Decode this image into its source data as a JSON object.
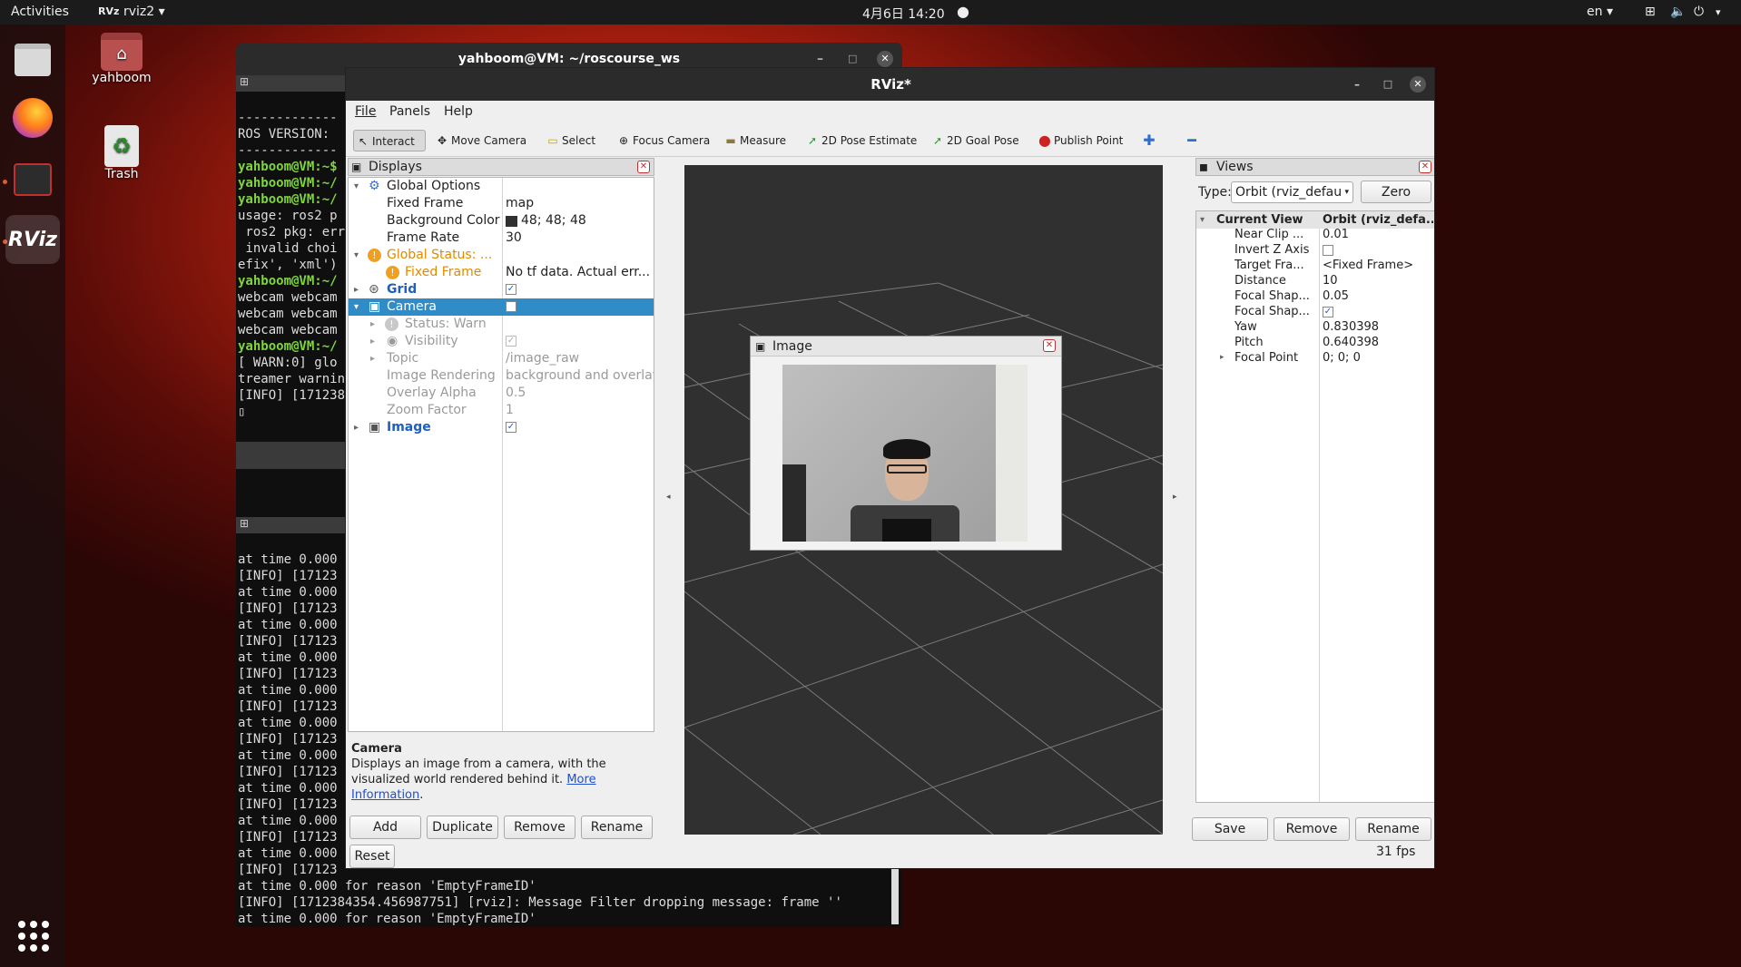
{
  "topbar": {
    "activities": "Activities",
    "app": "rviz2",
    "clock": "4月6日  14:20",
    "lang": "en"
  },
  "desktop": {
    "home": "yahboom",
    "trash": "Trash"
  },
  "terminal": {
    "title": "yahboom@VM: ~/roscourse_ws",
    "lines1": [
      "-------------",
      "ROS VERSION:",
      "-------------"
    ],
    "lines1b": [
      "usage: ros2 p",
      " ros2 pkg: erro",
      " invalid choi",
      "efix', 'xml')"
    ],
    "prompt": "yahboom@VM:~/",
    "prompt0": "yahboom@VM:~$",
    "webcam": [
      "webcam webcam",
      "webcam webcam",
      "webcam webcam"
    ],
    "warn": "[ WARN:0] glo",
    "treamer": "treamer warnin",
    "info1": "[INFO] [171238",
    "lines2": [
      "at time 0.000",
      "[INFO] [17123",
      "at time 0.000",
      "[INFO] [17123",
      "at time 0.000",
      "[INFO] [17123",
      "at time 0.000",
      "[INFO] [17123",
      "at time 0.000",
      "[INFO] [17123",
      "at time 0.000",
      "[INFO] [17123",
      "at time 0.000",
      "[INFO] [17123",
      "at time 0.000",
      "[INFO] [17123",
      "at time 0.000",
      "[INFO] [17123",
      "at time 0.000",
      "[INFO] [17123"
    ],
    "tail": [
      "at time 0.000 for reason 'EmptyFrameID'",
      "[INFO] [1712384354.456987751] [rviz]: Message Filter dropping message: frame ''",
      "at time 0.000 for reason 'EmptyFrameID'"
    ]
  },
  "rviz": {
    "title": "RViz*",
    "menu": [
      "File",
      "Panels",
      "Help"
    ],
    "tools": [
      "Interact",
      "Move Camera",
      "Select",
      "Focus Camera",
      "Measure",
      "2D Pose Estimate",
      "2D Goal Pose",
      "Publish Point"
    ],
    "displays": {
      "header": "Displays",
      "rows": [
        {
          "k": "Global Options",
          "v": ""
        },
        {
          "k": "Fixed Frame",
          "v": "map"
        },
        {
          "k": "Background Color",
          "v": "48; 48; 48"
        },
        {
          "k": "Frame Rate",
          "v": "30"
        },
        {
          "k": "Global Status: ...",
          "v": ""
        },
        {
          "k": "Fixed Frame",
          "v": "No tf data.  Actual err..."
        },
        {
          "k": "Grid",
          "v": ""
        },
        {
          "k": "Camera",
          "v": ""
        },
        {
          "k": "Status: Warn",
          "v": ""
        },
        {
          "k": "Visibility",
          "v": ""
        },
        {
          "k": "Topic",
          "v": "/image_raw"
        },
        {
          "k": "Image Rendering",
          "v": "background and overlay"
        },
        {
          "k": "Overlay Alpha",
          "v": "0.5"
        },
        {
          "k": "Zoom Factor",
          "v": "1"
        },
        {
          "k": "Image",
          "v": ""
        }
      ],
      "desc_title": "Camera",
      "desc": "Displays an image from a camera, with the visualized world rendered behind it.",
      "desc_link1": "More",
      "desc_link2": "Information",
      "buttons": [
        "Add",
        "Duplicate",
        "Remove",
        "Rename",
        "Reset"
      ]
    },
    "image_panel": {
      "title": "Image"
    },
    "views": {
      "header": "Views",
      "type_label": "Type:",
      "type_value": "Orbit (rviz_defau",
      "zero": "Zero",
      "col1": "Current View",
      "col2": "Orbit (rviz_defa...",
      "rows": [
        {
          "k": "Near Clip ...",
          "v": "0.01"
        },
        {
          "k": "Invert Z Axis",
          "v": ""
        },
        {
          "k": "Target Fra...",
          "v": "<Fixed Frame>"
        },
        {
          "k": "Distance",
          "v": "10"
        },
        {
          "k": "Focal Shap...",
          "v": "0.05"
        },
        {
          "k": "Focal Shap...",
          "v": ""
        },
        {
          "k": "Yaw",
          "v": "0.830398"
        },
        {
          "k": "Pitch",
          "v": "0.640398"
        },
        {
          "k": "Focal Point",
          "v": "0; 0; 0"
        }
      ],
      "buttons": [
        "Save",
        "Remove",
        "Rename"
      ],
      "fps": "31 fps"
    }
  }
}
